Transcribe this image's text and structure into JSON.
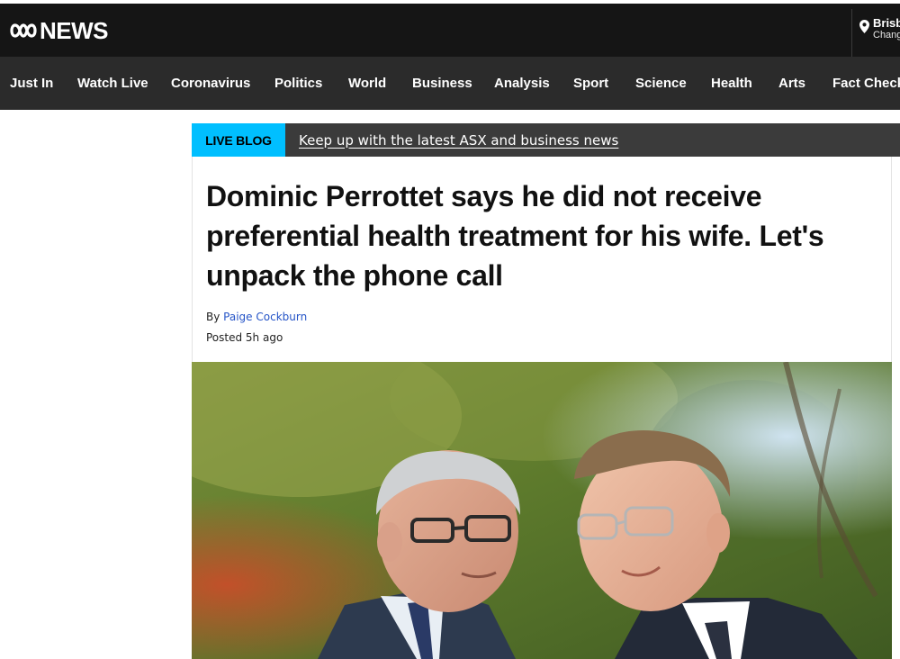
{
  "brand": {
    "logo_text": "NEWS"
  },
  "location": {
    "city": "Brisbane",
    "change_label": "Change"
  },
  "nav": {
    "items": [
      "Just In",
      "Watch Live",
      "Coronavirus",
      "Politics",
      "World",
      "Business",
      "Analysis",
      "Sport",
      "Science",
      "Health",
      "Arts",
      "Fact Check"
    ]
  },
  "live_blog": {
    "badge": "LIVE BLOG",
    "link": "Keep up with the latest ASX and business news"
  },
  "article": {
    "headline": "Dominic Perrottet says he did not receive preferential health treatment for his wife. Let's unpack the phone call",
    "by_prefix": "By",
    "author": "Paige Cockburn",
    "posted": "Posted 5h ago"
  },
  "colors": {
    "masthead": "#151515",
    "navbar": "#2b2b2b",
    "live_badge": "#00bfff",
    "banner": "#3b3b3b",
    "author_link": "#2554c7"
  }
}
